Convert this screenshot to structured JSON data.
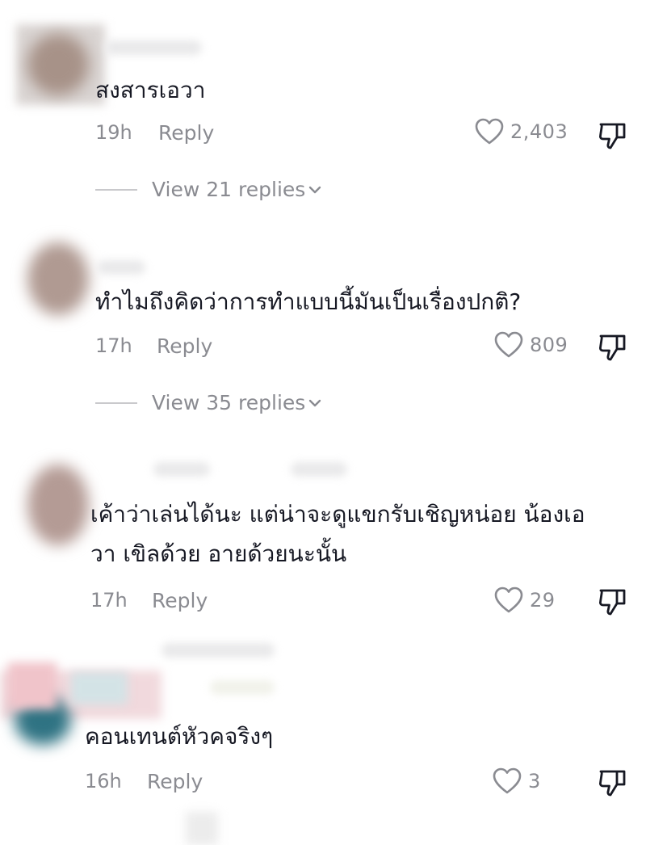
{
  "comments": [
    {
      "text": "สงสารเอวา",
      "time": "19h",
      "reply_label": "Reply",
      "likes": "2,403",
      "view_replies": "View 21 replies"
    },
    {
      "text": "ทำไมถึงคิดว่าการทำแบบนี้มันเป็นเรื่องปกติ?",
      "time": "17h",
      "reply_label": "Reply",
      "likes": "809",
      "view_replies": "View 35 replies"
    },
    {
      "text_line1": "เค้าว่าเล่นได้นะ แต่น่าจะดูแขกรับเชิญหน่อย น้องเอ",
      "text_line2": "วา เขิลด้วย อายด้วยนะนั้น",
      "time": "17h",
      "reply_label": "Reply",
      "likes": "29"
    },
    {
      "text": "คอนเทนต์หัวคจริงๆ",
      "time": "16h",
      "reply_label": "Reply",
      "likes": "3"
    }
  ],
  "colors": {
    "text": "#161823",
    "secondary": "#8a8b91",
    "divider": "#c9c9cc"
  },
  "icons": [
    "heart-icon",
    "dislike-icon",
    "chevron-down-icon"
  ]
}
